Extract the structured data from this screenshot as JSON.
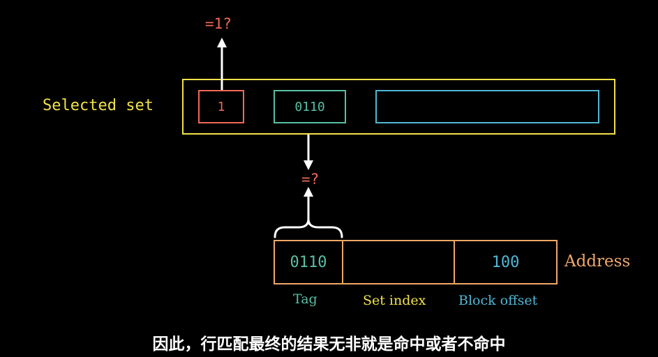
{
  "selected_set": {
    "label": "Selected set",
    "valid_bit": "1",
    "tag": "0110",
    "block": ""
  },
  "comparisons": {
    "valid_check": "=1?",
    "tag_check": "=?"
  },
  "address": {
    "label": "Address",
    "tag_value": "0110",
    "set_index_value": "",
    "block_offset_value": "100",
    "tag_label": "Tag",
    "set_index_label": "Set index",
    "block_offset_label": "Block offset"
  },
  "subtitle": "因此，行匹配最终的结果无非就是命中或者不命中",
  "colors": {
    "background": "#000000",
    "yellow": "#f2e24a",
    "red": "#f06a57",
    "teal": "#58c0a6",
    "blue": "#4fb8d6",
    "orange": "#f0a868",
    "white": "#ffffff"
  }
}
